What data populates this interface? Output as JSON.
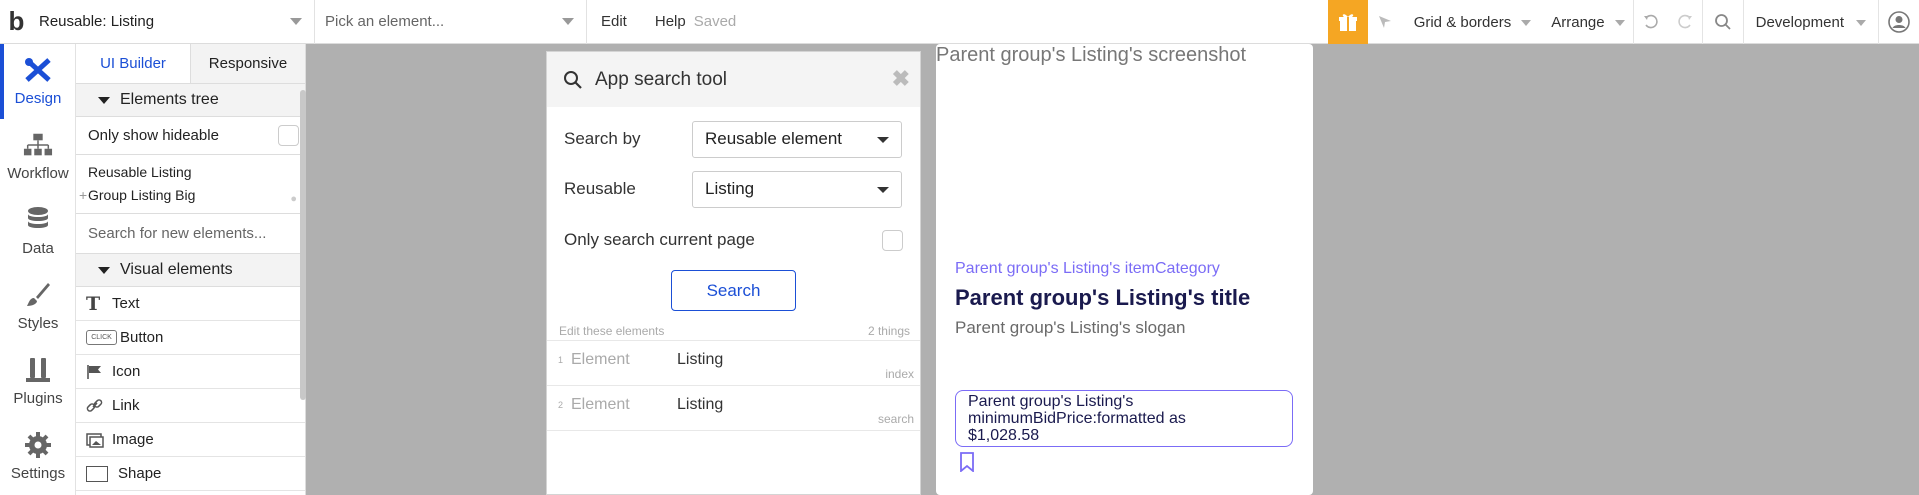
{
  "topbar": {
    "logo": "b",
    "page_select": "Reusable: Listing",
    "element_picker": "Pick an element...",
    "menu_edit": "Edit",
    "menu_help": "Help",
    "saved": "Saved",
    "grid_borders": "Grid & borders",
    "arrange": "Arrange",
    "environment": "Development"
  },
  "leftnav": {
    "design": "Design",
    "workflow": "Workflow",
    "data": "Data",
    "styles": "Styles",
    "plugins": "Plugins",
    "settings": "Settings"
  },
  "panel": {
    "tab_ui_builder": "UI Builder",
    "tab_responsive": "Responsive",
    "elements_tree": "Elements tree",
    "only_show_hideable": "Only show hideable",
    "tree_items": [
      "Reusable Listing",
      "Group Listing Big"
    ],
    "search_placeholder": "Search for new elements...",
    "visual_elements": "Visual elements",
    "elements": [
      "Text",
      "Button",
      "Icon",
      "Link",
      "Image",
      "Shape"
    ],
    "button_icon_text": "CLICK"
  },
  "search_tool": {
    "title": "App search tool",
    "search_by_label": "Search by",
    "search_by_value": "Reusable element",
    "reusable_label": "Reusable",
    "reusable_value": "Listing",
    "only_current_page": "Only search current page",
    "search_button": "Search",
    "edit_these": "Edit these elements",
    "count": "2 things",
    "results": [
      {
        "num": "1",
        "kind": "Element",
        "value": "Listing",
        "tag": "index"
      },
      {
        "num": "2",
        "kind": "Element",
        "value": "Listing",
        "tag": "search"
      }
    ]
  },
  "card": {
    "screenshot": "Parent group's Listing's screenshot",
    "category": "Parent group's Listing's itemCategory",
    "title": "Parent group's Listing's title",
    "slogan": "Parent group's Listing's slogan",
    "price_line1": "Parent group's Listing's",
    "price_line2": "minimumBidPrice:formatted as",
    "price_line3": "$1,028.58"
  },
  "colors": {
    "accent": "#1b4fd6",
    "gift": "#f5a623",
    "card_purple": "#7b6cf6",
    "card_title": "#1a1a4e"
  }
}
